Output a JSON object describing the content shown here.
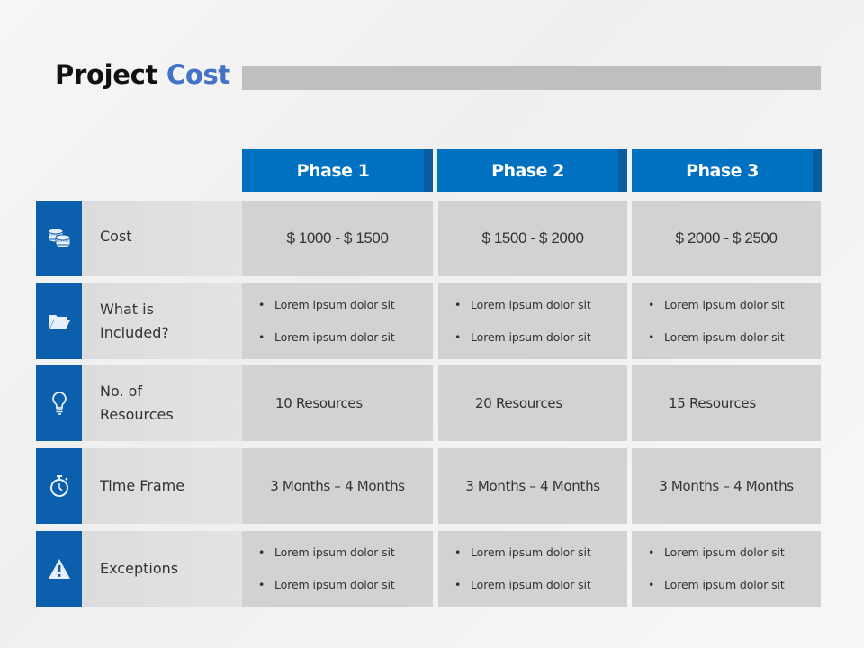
{
  "title": {
    "main": "Project",
    "accent": "Cost"
  },
  "colors": {
    "primary": "#0070c0",
    "icon_bg": "#0b5fad",
    "accent_text": "#4472c4",
    "cell_bg": "#d2d2d2",
    "title_bar": "#bfbfbf"
  },
  "phases": [
    "Phase 1",
    "Phase 2",
    "Phase 3"
  ],
  "rows": [
    {
      "icon": "coins-icon",
      "label": "Cost",
      "values": [
        "$ 1000 - $ 1500",
        "$ 1500 - $ 2000",
        "$ 2000 - $ 2500"
      ]
    },
    {
      "icon": "folder-open-icon",
      "label": "What is Included?",
      "values": [
        [
          "Lorem ipsum dolor sit",
          "Lorem ipsum dolor sit"
        ],
        [
          "Lorem ipsum dolor sit",
          "Lorem ipsum dolor sit"
        ],
        [
          "Lorem ipsum dolor sit",
          "Lorem ipsum dolor sit"
        ]
      ]
    },
    {
      "icon": "lightbulb-icon",
      "label": "No. of Resources",
      "values": [
        "10 Resources",
        "20 Resources",
        "15 Resources"
      ]
    },
    {
      "icon": "stopwatch-icon",
      "label": "Time Frame",
      "values": [
        "3 Months – 4 Months",
        "3 Months – 4 Months",
        "3 Months – 4 Months"
      ]
    },
    {
      "icon": "warning-icon",
      "label": "Exceptions",
      "values": [
        [
          "Lorem ipsum dolor sit",
          "Lorem ipsum dolor sit"
        ],
        [
          "Lorem ipsum dolor sit",
          "Lorem ipsum dolor sit"
        ],
        [
          "Lorem ipsum dolor sit",
          "Lorem ipsum dolor sit"
        ]
      ]
    }
  ]
}
